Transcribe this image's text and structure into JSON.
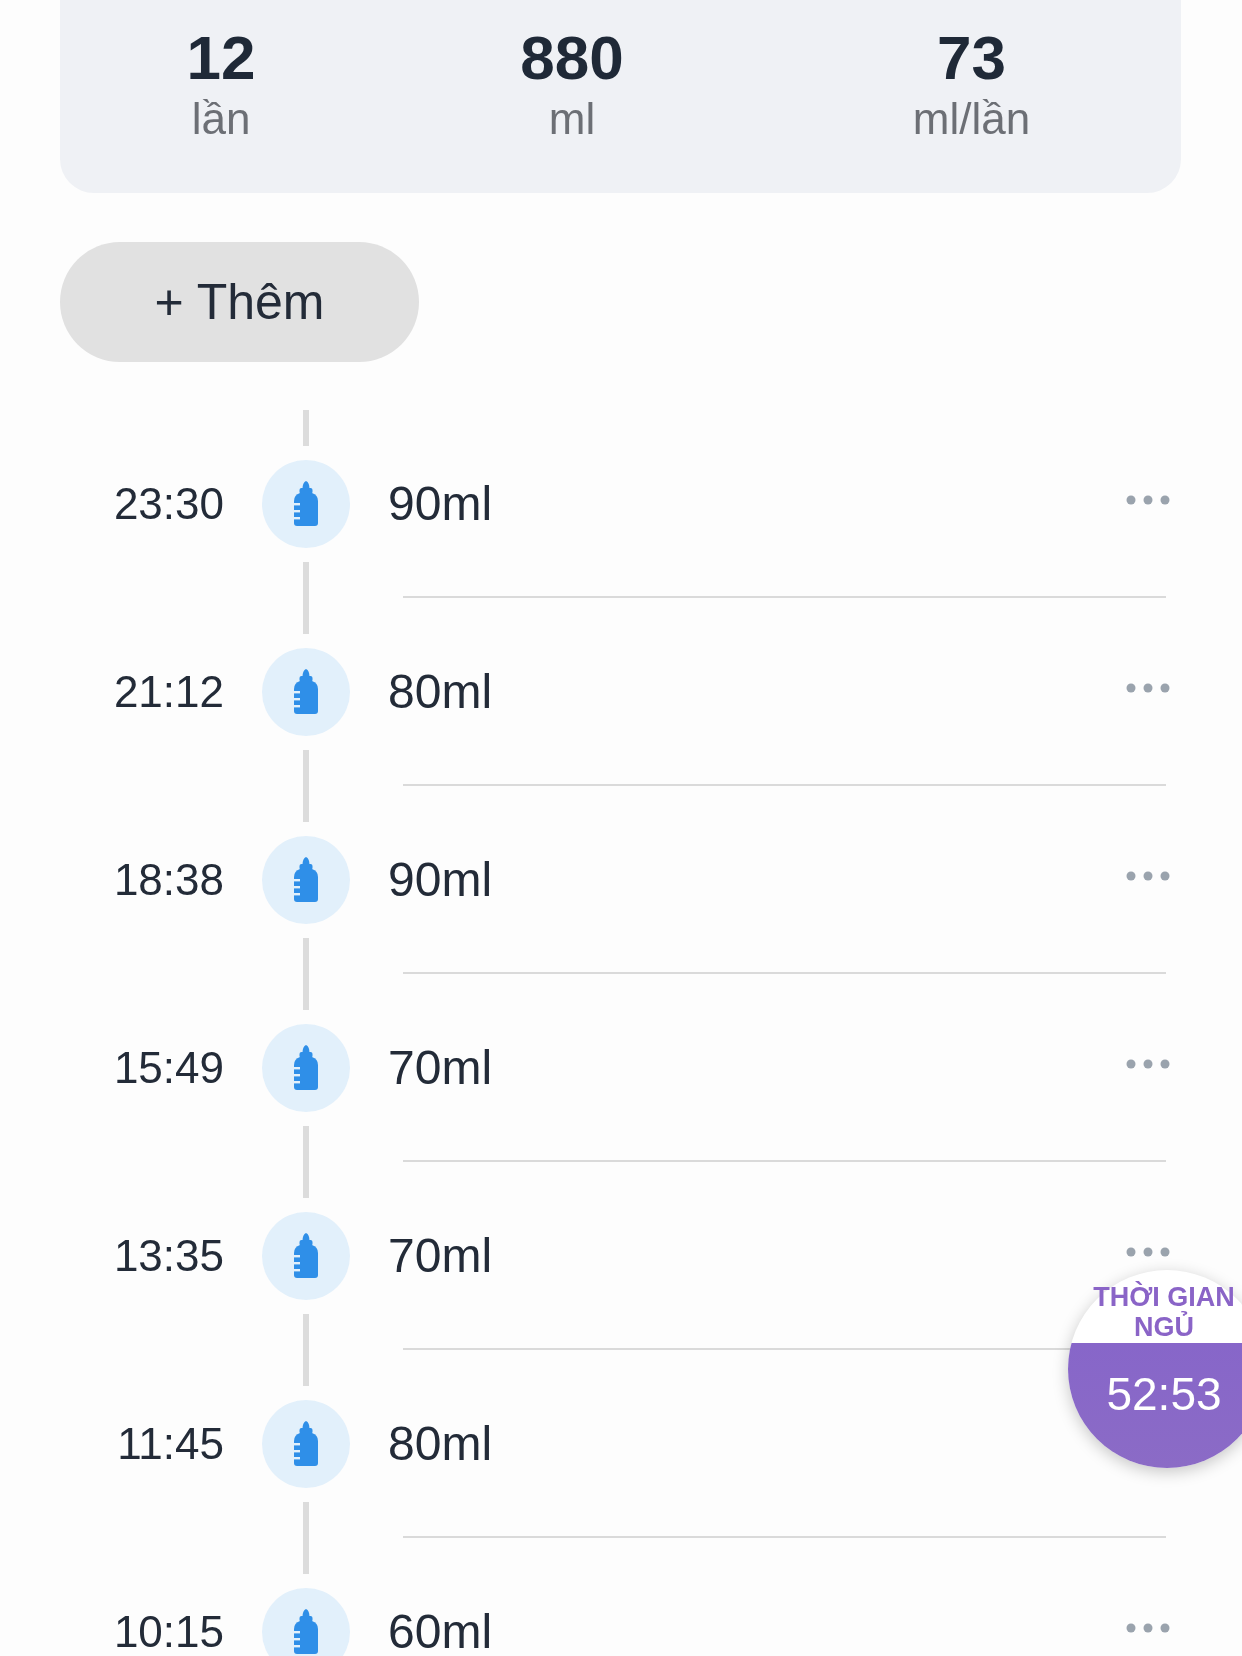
{
  "summary": {
    "stats": [
      {
        "value": "12",
        "unit": "lần"
      },
      {
        "value": "880",
        "unit": "ml"
      },
      {
        "value": "73",
        "unit": "ml/lần"
      }
    ]
  },
  "add_button": {
    "label": "+ Thêm"
  },
  "feedings": [
    {
      "time": "23:30",
      "amount": "90ml",
      "more_button": true
    },
    {
      "time": "21:12",
      "amount": "80ml",
      "more_button": true
    },
    {
      "time": "18:38",
      "amount": "90ml",
      "more_button": true
    },
    {
      "time": "15:49",
      "amount": "70ml",
      "more_button": true
    },
    {
      "time": "13:35",
      "amount": "70ml",
      "more_button": true
    },
    {
      "time": "11:45",
      "amount": "80ml",
      "more_button": false
    },
    {
      "time": "10:15",
      "amount": "60ml",
      "more_button": true
    }
  ],
  "sleep_timer": {
    "label": "THỜI GIAN NGỦ",
    "value": "52:53"
  }
}
